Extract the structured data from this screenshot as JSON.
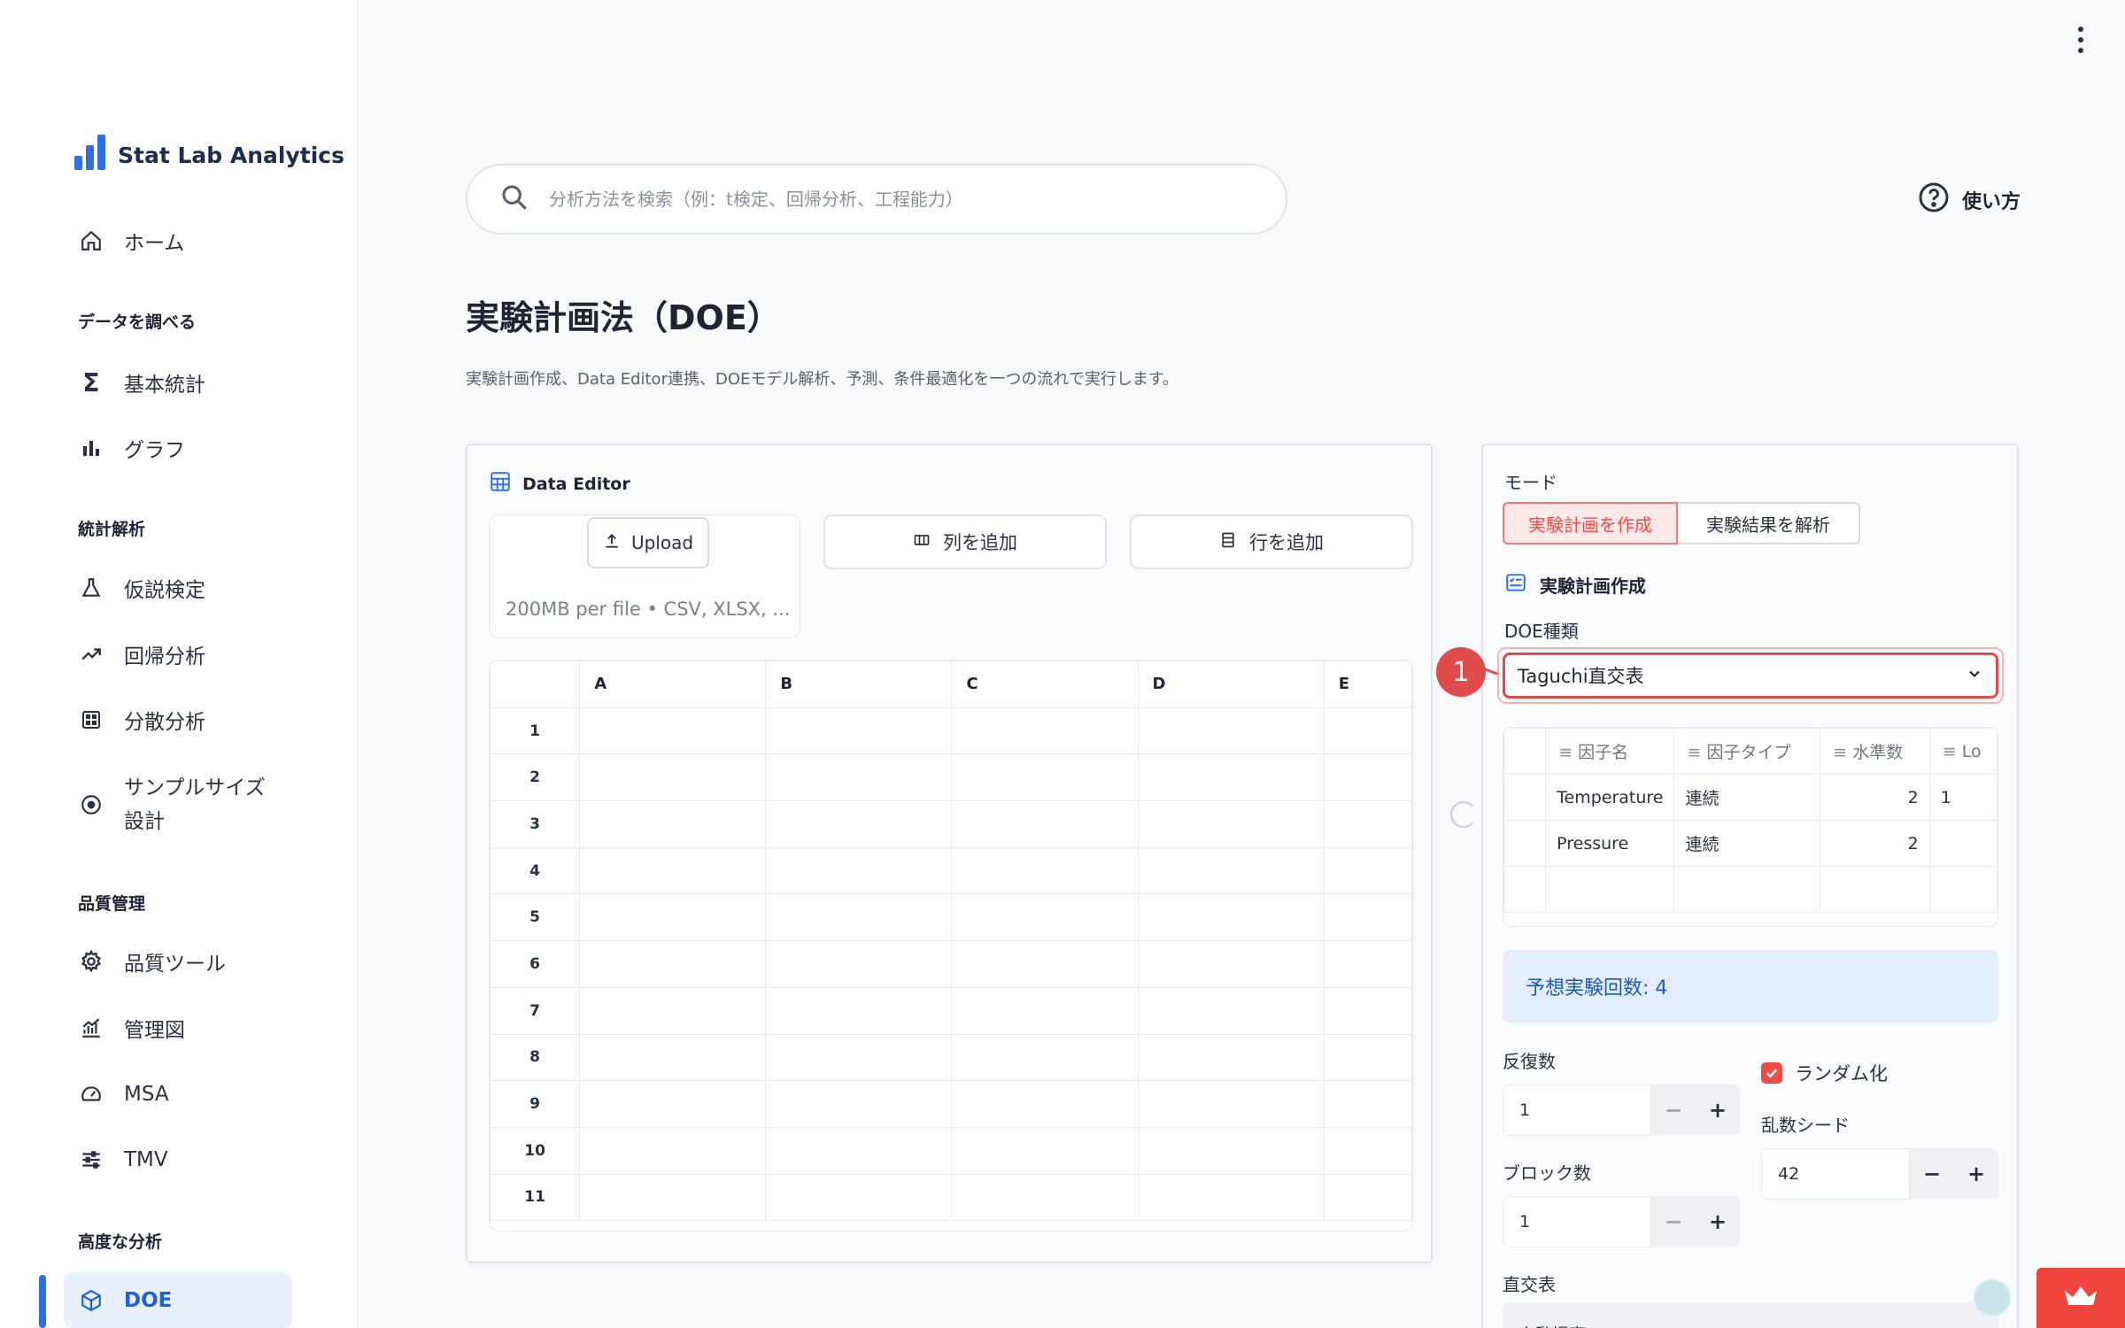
{
  "app": {
    "name": "Stat Lab Analytics"
  },
  "sidebar": {
    "home": "ホーム",
    "sections": [
      {
        "title": "データを調べる",
        "items": [
          "基本統計",
          "グラフ"
        ]
      },
      {
        "title": "統計解析",
        "items": [
          "仮説検定",
          "回帰分析",
          "分散分析",
          "サンプルサイズ設計"
        ]
      },
      {
        "title": "品質管理",
        "items": [
          "品質ツール",
          "管理図",
          "MSA",
          "TMV"
        ]
      },
      {
        "title": "高度な分析",
        "items": [
          "DOE"
        ]
      }
    ],
    "active": "DOE"
  },
  "header": {
    "search_placeholder": "分析方法を検索（例：t検定、回帰分析、工程能力）",
    "help_label": "使い方"
  },
  "page": {
    "title": "実験計画法（DOE）",
    "description": "実験計画作成、Data Editor連携、DOEモデル解析、予測、条件最適化を一つの流れで実行します。"
  },
  "data_editor": {
    "title": "Data Editor",
    "upload_label": "Upload",
    "upload_hint": "200MB per file • CSV, XLSX, ...",
    "add_column": "列を追加",
    "add_row": "行を追加",
    "columns": [
      "A",
      "B",
      "C",
      "D",
      "E"
    ],
    "rows": [
      "1",
      "2",
      "3",
      "4",
      "5",
      "6",
      "7",
      "8",
      "9",
      "10",
      "11"
    ]
  },
  "design_panel": {
    "mode_label": "モード",
    "mode_create": "実験計画を作成",
    "mode_analyze": "実験結果を解析",
    "section_title": "実験計画作成",
    "doe_type_label": "DOE種類",
    "doe_type_value": "Taguchi直交表",
    "factor_columns": [
      "因子名",
      "因子タイプ",
      "水準数",
      "Lo"
    ],
    "factors": [
      {
        "name": "Temperature",
        "type": "連続",
        "levels": "2",
        "low": "1"
      },
      {
        "name": "Pressure",
        "type": "連続",
        "levels": "2",
        "low": ""
      }
    ],
    "expected_runs": "予想実験回数: 4",
    "replicates_label": "反復数",
    "replicates_value": "1",
    "blocks_label": "ブロック数",
    "blocks_value": "1",
    "randomize_label": "ランダム化",
    "seed_label": "乱数シード",
    "seed_value": "42",
    "orthogonal_label": "直交表",
    "orthogonal_value": "自動提案"
  },
  "annotation": {
    "marker": "1"
  },
  "colors": {
    "accent": "#2f6fe4",
    "danger": "#e04b4b",
    "info_bg": "#e2edfb"
  }
}
